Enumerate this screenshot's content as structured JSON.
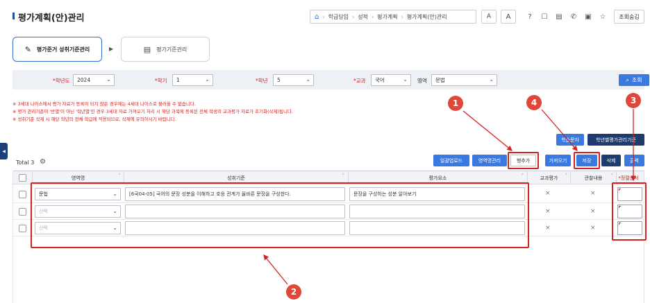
{
  "header": {
    "title": "평가계획(안)관리",
    "breadcrumb": [
      "학급담임",
      "성적",
      "평가계획",
      "평가계획(안)관리"
    ],
    "font_a_label": "A",
    "font_a2_label": "A",
    "query_label": "조회숨김"
  },
  "steps": {
    "step1": "평가준거 성취기준관리",
    "step2": "평가기준관리"
  },
  "filters": {
    "year_label": "*학년도",
    "year_value": "2024",
    "semester_label": "*학기",
    "semester_value": "1",
    "grade_label": "*학년",
    "grade_value": "5",
    "subject_label": "*교과",
    "subject_value": "국어",
    "area_label": "영역",
    "area_value": "문법",
    "search_label": "조회"
  },
  "notices": [
    "※ 3세대 나이스에서 평가 자료가 등록이 되지 않은 경우에는 4세대 나이스로 불러올 수 없습니다.",
    "※ 평가 관리기준이 '반별'이 아닌 '학년별'인 경우 3세대 자료 가져오기 처리 시 해당 과목에 등록된 전체 학생의 교과평가 자료가 초기화(삭제)됩니다.",
    "※ 성취기준 삭제 시 해당 학년의 전체 학급에 적용되므로, 삭제에 유의하시기 바랍니다."
  ],
  "top_buttons": {
    "text_label": "학습문자",
    "grade_std_label": "학년별평가관리기준"
  },
  "toolbar": {
    "total_label": "Total 3",
    "bulk_upload": "일괄업로드",
    "area_manage": "영역명관리",
    "add_row": "행추가",
    "import": "가져오기",
    "save": "저장",
    "delete": "삭제",
    "print": "출력"
  },
  "table": {
    "headers": [
      "영역명",
      "성취기준",
      "평가요소",
      "교과평가",
      "관찰내용",
      "*정렬순서"
    ],
    "rows": [
      {
        "area": "문법",
        "standard": "[6국04-05] 국어의 문장 성분을 이해하고 호응 관계가 올바른 문장을 구성한다.",
        "element": "문장을 구성하는 성분 알아보기",
        "subject_eval": "×",
        "observe": "×"
      },
      {
        "area": "선택",
        "standard": "",
        "element": "",
        "subject_eval": "×",
        "observe": "×"
      },
      {
        "area": "선택",
        "standard": "",
        "element": "",
        "subject_eval": "×",
        "observe": "×"
      }
    ]
  },
  "annotations": [
    "1",
    "2",
    "3",
    "4"
  ],
  "side_tab_label": "◀",
  "colors": {
    "accent": "#3a7ae0",
    "navy": "#1d3b6e",
    "annotation": "#d6211f"
  }
}
